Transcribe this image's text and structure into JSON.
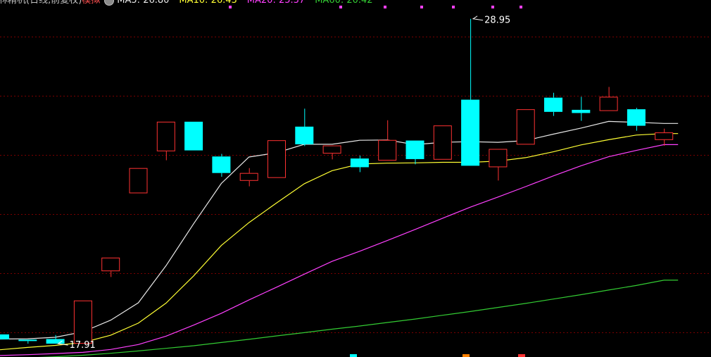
{
  "header": {
    "title": "林精机(日线,前复权)",
    "mode": "模拟",
    "ma_readouts": [
      {
        "label": "MA5: 26.80",
        "color": "#e8e8e8"
      },
      {
        "label": "MA10: 26.43",
        "color": "#ffff33"
      },
      {
        "label": "MA20: 25.37",
        "color": "#ff40ff"
      },
      {
        "label": "MA60: 20.42",
        "color": "#33cc33"
      }
    ]
  },
  "chart_data": {
    "type": "candlestick",
    "ylim": [
      17.45,
      29.77
    ],
    "colors": {
      "up": "#ff3232",
      "down": "#00ffff",
      "grid": "#7a0000",
      "ma5": "#e8e8e8",
      "ma10": "#ffff33",
      "ma20": "#ff40ff",
      "ma60": "#33cc33",
      "annotation": "#ffffff"
    },
    "candles": [
      {
        "open": 18.23,
        "close": 18.06,
        "high": 18.23,
        "low": 18.06
      },
      {
        "open": 18.05,
        "close": 18.0,
        "high": 18.05,
        "low": 17.91
      },
      {
        "open": 18.07,
        "close": 17.91,
        "high": 18.21,
        "low": 17.91
      },
      {
        "open": 17.91,
        "close": 19.4,
        "high": 19.4,
        "low": 17.91
      },
      {
        "open": 20.41,
        "close": 20.88,
        "high": 20.88,
        "low": 20.21
      },
      {
        "open": 23.1,
        "close": 23.97,
        "high": 23.97,
        "low": 23.1
      },
      {
        "open": 24.55,
        "close": 25.57,
        "high": 25.57,
        "low": 24.24
      },
      {
        "open": 25.57,
        "close": 24.58,
        "high": 25.57,
        "low": 24.58
      },
      {
        "open": 24.37,
        "close": 23.8,
        "high": 24.46,
        "low": 23.67
      },
      {
        "open": 23.53,
        "close": 23.8,
        "high": 23.97,
        "low": 23.34
      },
      {
        "open": 23.63,
        "close": 24.93,
        "high": 24.93,
        "low": 23.63
      },
      {
        "open": 25.4,
        "close": 24.79,
        "high": 26.02,
        "low": 24.73
      },
      {
        "open": 24.47,
        "close": 24.75,
        "high": 24.75,
        "low": 24.27
      },
      {
        "open": 24.3,
        "close": 24.0,
        "high": 24.4,
        "low": 23.83
      },
      {
        "open": 24.23,
        "close": 24.94,
        "high": 25.62,
        "low": 24.23
      },
      {
        "open": 24.92,
        "close": 24.28,
        "high": 24.92,
        "low": 24.1
      },
      {
        "open": 24.26,
        "close": 25.44,
        "high": 25.44,
        "low": 24.26
      },
      {
        "open": 26.33,
        "close": 24.05,
        "high": 29.12,
        "low": 24.05
      },
      {
        "open": 24.0,
        "close": 24.63,
        "high": 24.63,
        "low": 23.54
      },
      {
        "open": 24.78,
        "close": 26.0,
        "high": 26.0,
        "low": 24.78
      },
      {
        "open": 26.4,
        "close": 25.91,
        "high": 26.57,
        "low": 25.77
      },
      {
        "open": 25.98,
        "close": 25.87,
        "high": 26.43,
        "low": 25.6
      },
      {
        "open": 25.94,
        "close": 26.43,
        "high": 26.77,
        "low": 25.94
      },
      {
        "open": 26.0,
        "close": 25.43,
        "high": 26.05,
        "low": 25.26
      },
      {
        "open": 24.94,
        "close": 25.2,
        "high": 25.33,
        "low": 24.74
      }
    ],
    "ma5": [
      18.07,
      18.08,
      18.13,
      18.32,
      18.72,
      19.32,
      20.6,
      22.05,
      23.44,
      24.35,
      24.5,
      24.79,
      24.79,
      24.93,
      24.94,
      24.78,
      24.86,
      24.88,
      24.86,
      24.92,
      25.14,
      25.35,
      25.58,
      25.55,
      25.51
    ],
    "ma10": [
      17.7,
      17.78,
      17.85,
      17.95,
      18.2,
      18.62,
      19.31,
      20.25,
      21.3,
      22.09,
      22.77,
      23.43,
      23.88,
      24.11,
      24.14,
      24.15,
      24.17,
      24.17,
      24.21,
      24.33,
      24.53,
      24.77,
      24.95,
      25.11,
      25.16
    ],
    "ma20": [
      17.5,
      17.53,
      17.57,
      17.61,
      17.71,
      17.88,
      18.17,
      18.55,
      18.96,
      19.42,
      19.86,
      20.31,
      20.75,
      21.1,
      21.47,
      21.85,
      22.24,
      22.62,
      22.97,
      23.33,
      23.7,
      24.05,
      24.36,
      24.58,
      24.78
    ],
    "ma60": [
      17.38,
      17.42,
      17.46,
      17.51,
      17.58,
      17.66,
      17.75,
      17.84,
      17.95,
      18.06,
      18.18,
      18.29,
      18.41,
      18.52,
      18.64,
      18.76,
      18.89,
      19.02,
      19.16,
      19.3,
      19.45,
      19.6,
      19.76,
      19.92,
      20.1
    ],
    "annotations": [
      {
        "text": "17.91",
        "candle": 2,
        "value": 17.91
      },
      {
        "text": "28.95",
        "candle": 17,
        "value": 29.12
      }
    ]
  }
}
